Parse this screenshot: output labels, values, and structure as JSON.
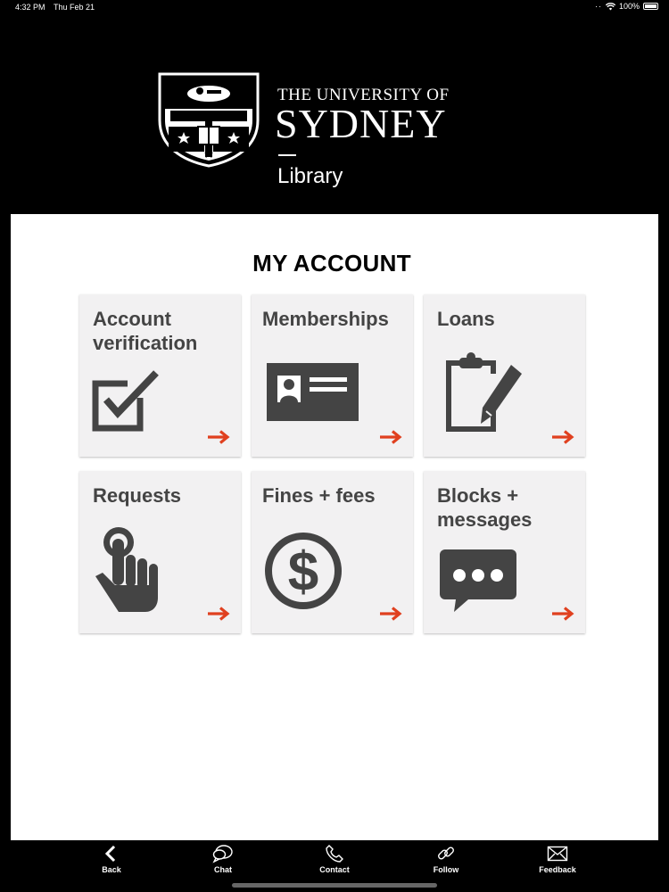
{
  "status_bar": {
    "time": "4:32 PM",
    "date": "Thu Feb 21",
    "battery": "100%"
  },
  "header": {
    "line1": "THE UNIVERSITY OF",
    "line2": "SYDNEY",
    "library": "Library"
  },
  "page_title": "MY ACCOUNT",
  "tiles": [
    {
      "label": "Account verification",
      "icon": "checkbox-icon"
    },
    {
      "label": "Memberships",
      "icon": "id-card-icon"
    },
    {
      "label": "Loans",
      "icon": "clipboard-pencil-icon"
    },
    {
      "label": "Requests",
      "icon": "pointing-hand-icon"
    },
    {
      "label": "Fines + fees",
      "icon": "dollar-coin-icon"
    },
    {
      "label": "Blocks + messages",
      "icon": "chat-bubble-icon"
    }
  ],
  "colors": {
    "arrow": "#e0401f",
    "icon": "#444444",
    "tile_bg": "#f2f1f2"
  },
  "bottom_nav": [
    {
      "label": "Back",
      "icon": "chevron-left-icon"
    },
    {
      "label": "Chat",
      "icon": "chat-icon"
    },
    {
      "label": "Contact",
      "icon": "phone-icon"
    },
    {
      "label": "Follow",
      "icon": "link-icon"
    },
    {
      "label": "Feedback",
      "icon": "envelope-icon"
    }
  ]
}
